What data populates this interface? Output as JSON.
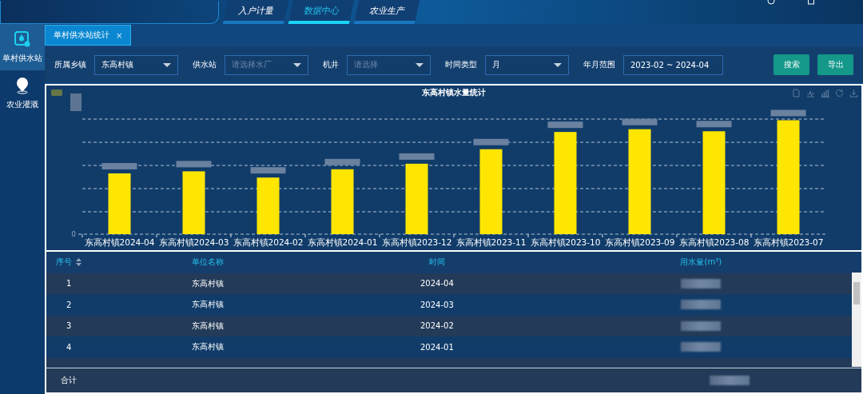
{
  "header": {
    "nav": [
      {
        "label": "入户计量",
        "selected": false
      },
      {
        "label": "数据中心",
        "selected": true
      },
      {
        "label": "农业生产",
        "selected": false
      }
    ]
  },
  "sidebar": {
    "items": [
      {
        "label": "单村供水站",
        "selected": true
      },
      {
        "label": "农业灌溉",
        "selected": false
      }
    ]
  },
  "tabs": [
    {
      "label": "单村供水站统计",
      "selected": true,
      "close": "×"
    }
  ],
  "filters": [
    {
      "label": "所属乡镇",
      "value": "东高村镇",
      "kind": "select"
    },
    {
      "label": "供水站",
      "placeholder": "请选择水厂",
      "kind": "select"
    },
    {
      "label": "机井",
      "placeholder": "请选择",
      "kind": "select"
    },
    {
      "label": "时间类型",
      "value": "月",
      "kind": "select"
    },
    {
      "label": "年月范围",
      "value": "2023-02 ~ 2024-04",
      "kind": "range"
    }
  ],
  "buttons": [
    "搜索",
    "导出"
  ],
  "chart": {
    "title": "东高村镇水量统计",
    "y_zero": "0",
    "categories": [
      "东高村镇2024-04",
      "东高村镇2024-03",
      "东高村镇2024-02",
      "东高村镇2024-01",
      "东高村镇2023-12",
      "东高村镇2023-11",
      "东高村镇2023-10",
      "东高村镇2023-09",
      "东高村镇2023-08",
      "东高村镇2023-07"
    ]
  },
  "table": {
    "columns": [
      "序号",
      "单位名称",
      "时间",
      "用水量(m³)"
    ],
    "rows": [
      {
        "index": "1",
        "unit": "东高村镇",
        "time": "2024-04"
      },
      {
        "index": "2",
        "unit": "东高村镇",
        "time": "2024-03"
      },
      {
        "index": "3",
        "unit": "东高村镇",
        "time": "2024-02"
      },
      {
        "index": "4",
        "unit": "东高村镇",
        "time": "2024-01"
      }
    ],
    "footer": "合计"
  }
}
